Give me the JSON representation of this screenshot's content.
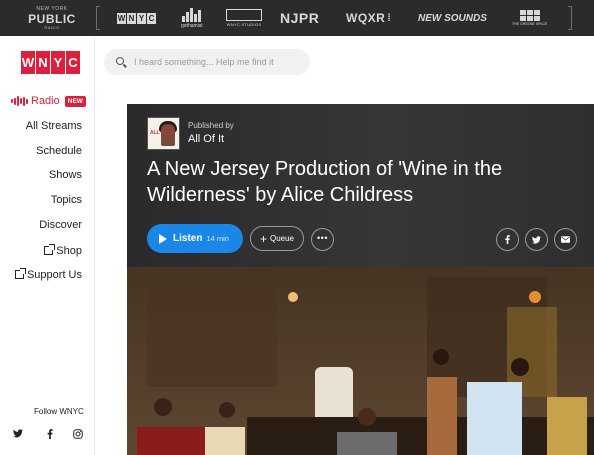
{
  "network": {
    "nyp_line1": "NEW YORK",
    "nyp_line2": "PUBLIC",
    "nyp_line3": "RADIO",
    "wnyc_letters": [
      "W",
      "N",
      "Y",
      "C"
    ],
    "gothamist": "gothamist",
    "studios": "WNYC STUDIOS",
    "njpr": "NJPR",
    "wqxr": "WQXR",
    "new_sounds": "NEW SOUNDS",
    "greene": "THE GREENE SPACE"
  },
  "sidebar": {
    "logo_letters": [
      "W",
      "N",
      "Y",
      "C"
    ],
    "radio_label": "Radio",
    "new_badge": "NEW",
    "items": [
      {
        "label": "All Streams"
      },
      {
        "label": "Schedule"
      },
      {
        "label": "Shows"
      },
      {
        "label": "Topics"
      },
      {
        "label": "Discover"
      },
      {
        "label": "Shop"
      },
      {
        "label": "Support Us"
      }
    ],
    "follow_label": "Follow WNYC",
    "social_icons": [
      "twitter-icon",
      "facebook-icon",
      "instagram-icon"
    ]
  },
  "search": {
    "placeholder": "I heard something... Help me find it"
  },
  "episode": {
    "published_by_label": "Published by",
    "show_name": "All Of It",
    "thumb_text": "ALL OF IT",
    "title": "A New Jersey Production of 'Wine in the Wilderness' by Alice Childress",
    "listen_label": "Listen",
    "duration": "14 min",
    "queue_label": "Queue",
    "more_label": "•••",
    "share_icons": [
      "facebook-icon",
      "twitter-icon",
      "email-icon"
    ]
  },
  "colors": {
    "brand_red": "#de1e3d",
    "listen_blue": "#1a86e8",
    "topbar_bg": "#2b2b2b"
  }
}
